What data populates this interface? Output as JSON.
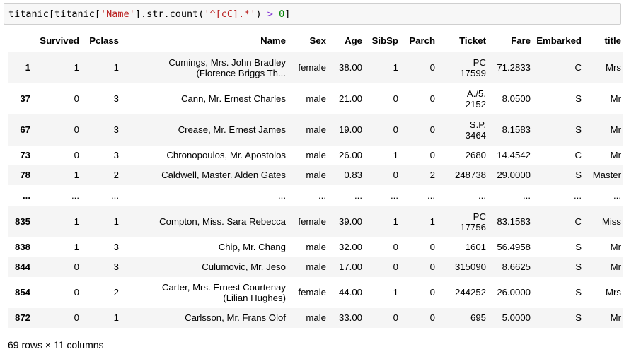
{
  "code_cell": {
    "segments": [
      {
        "text": "titanic[titanic[",
        "kind": "plain"
      },
      {
        "text": "'Name'",
        "kind": "str"
      },
      {
        "text": "].str.count(",
        "kind": "plain"
      },
      {
        "text": "'^[cC].*'",
        "kind": "str"
      },
      {
        "text": ") ",
        "kind": "plain"
      },
      {
        "text": ">",
        "kind": "op"
      },
      {
        "text": " ",
        "kind": "plain"
      },
      {
        "text": "0",
        "kind": "num"
      },
      {
        "text": "]",
        "kind": "plain"
      }
    ]
  },
  "table": {
    "columns": [
      "",
      "Survived",
      "Pclass",
      "Name",
      "Sex",
      "Age",
      "SibSp",
      "Parch",
      "Ticket",
      "Fare",
      "Embarked",
      "title"
    ],
    "rows": [
      {
        "index": "1",
        "cells": [
          "1",
          "1",
          "Cumings, Mrs. John Bradley (Florence Briggs Th...",
          "female",
          "38.00",
          "1",
          "0",
          "PC 17599",
          "71.2833",
          "C",
          "Mrs"
        ],
        "height": "tall"
      },
      {
        "index": "37",
        "cells": [
          "0",
          "3",
          "Cann, Mr. Ernest Charles",
          "male",
          "21.00",
          "0",
          "0",
          "A./5. 2152",
          "8.0500",
          "S",
          "Mr"
        ],
        "height": "tall"
      },
      {
        "index": "67",
        "cells": [
          "0",
          "3",
          "Crease, Mr. Ernest James",
          "male",
          "19.00",
          "0",
          "0",
          "S.P. 3464",
          "8.1583",
          "S",
          "Mr"
        ],
        "height": "tall"
      },
      {
        "index": "73",
        "cells": [
          "0",
          "3",
          "Chronopoulos, Mr. Apostolos",
          "male",
          "26.00",
          "1",
          "0",
          "2680",
          "14.4542",
          "C",
          "Mr"
        ],
        "height": "short"
      },
      {
        "index": "78",
        "cells": [
          "1",
          "2",
          "Caldwell, Master. Alden Gates",
          "male",
          "0.83",
          "0",
          "2",
          "248738",
          "29.0000",
          "S",
          "Master"
        ],
        "height": "short"
      },
      {
        "index": "...",
        "cells": [
          "...",
          "...",
          "...",
          "...",
          "...",
          "...",
          "...",
          "...",
          "...",
          "...",
          "..."
        ],
        "height": "ell"
      },
      {
        "index": "835",
        "cells": [
          "1",
          "1",
          "Compton, Miss. Sara Rebecca",
          "female",
          "39.00",
          "1",
          "1",
          "PC 17756",
          "83.1583",
          "C",
          "Miss"
        ],
        "height": "tall"
      },
      {
        "index": "838",
        "cells": [
          "1",
          "3",
          "Chip, Mr. Chang",
          "male",
          "32.00",
          "0",
          "0",
          "1601",
          "56.4958",
          "S",
          "Mr"
        ],
        "height": "short"
      },
      {
        "index": "844",
        "cells": [
          "0",
          "3",
          "Culumovic, Mr. Jeso",
          "male",
          "17.00",
          "0",
          "0",
          "315090",
          "8.6625",
          "S",
          "Mr"
        ],
        "height": "short"
      },
      {
        "index": "854",
        "cells": [
          "0",
          "2",
          "Carter, Mrs. Ernest Courtenay (Lilian Hughes)",
          "female",
          "44.00",
          "1",
          "0",
          "244252",
          "26.0000",
          "S",
          "Mrs"
        ],
        "height": "tall"
      },
      {
        "index": "872",
        "cells": [
          "0",
          "1",
          "Carlsson, Mr. Frans Olof",
          "male",
          "33.00",
          "0",
          "0",
          "695",
          "5.0000",
          "S",
          "Mr"
        ],
        "height": "short"
      }
    ]
  },
  "footer": {
    "summary": "69 rows × 11 columns"
  },
  "colors": {
    "string": "#ba2121",
    "number": "#008000",
    "operator": "#7f2ed4",
    "stripe": "#f5f5f5",
    "cell_bg": "#f7f7f7"
  }
}
